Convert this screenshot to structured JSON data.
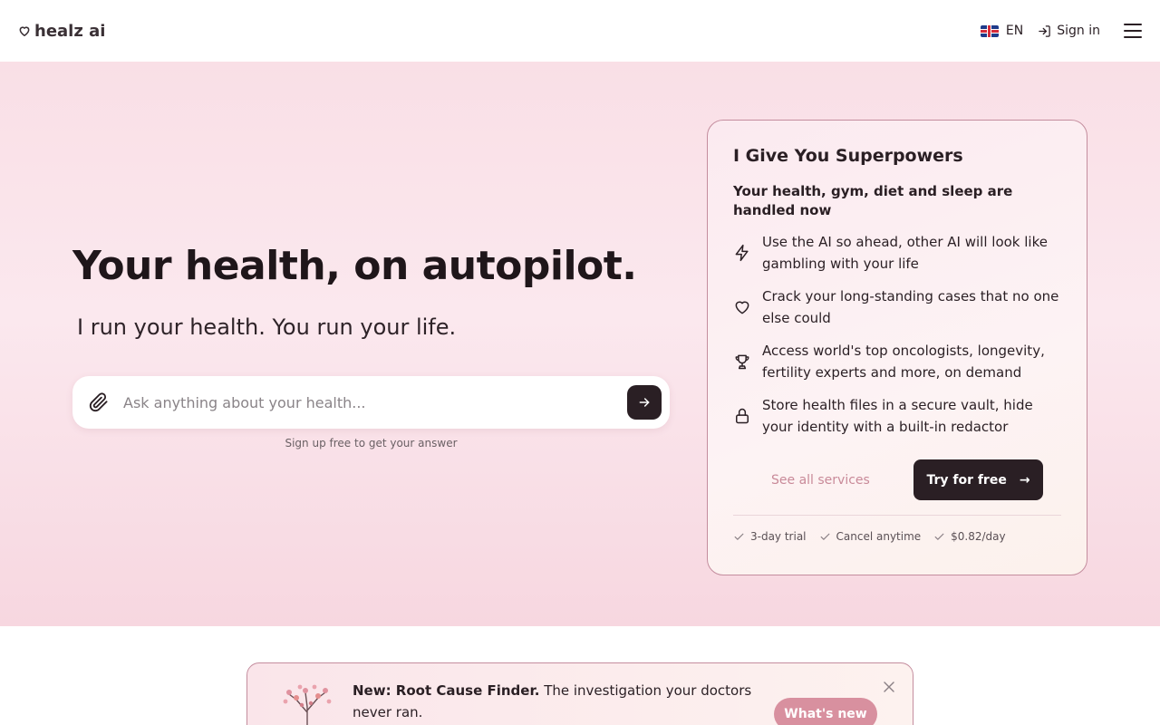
{
  "header": {
    "logo_text": "healz ai",
    "language": "EN",
    "signin_label": "Sign in"
  },
  "hero": {
    "headline": "Your health, on autopilot.",
    "subheadline": "I run your health. You run your life.",
    "ask_placeholder": "Ask anything about your health...",
    "ask_hint": "Sign up free to get your answer"
  },
  "card": {
    "title": "I Give You Superpowers",
    "lead": "Your health, gym, diet and sleep are handled now",
    "features": [
      {
        "icon": "bolt-icon",
        "text": "Use the AI so ahead, other AI will look like gambling with your life"
      },
      {
        "icon": "heart-icon",
        "text": "Crack your long-standing cases that no one else could"
      },
      {
        "icon": "trophy-icon",
        "text": "Access world's top oncologists, longevity, fertility experts and more, on demand"
      },
      {
        "icon": "lock-icon",
        "text": "Store health files in a secure vault, hide your identity with a built-in redactor"
      }
    ],
    "see_all_label": "See all services",
    "try_label": "Try for free",
    "try_arrow": "→",
    "perks": [
      "3-day trial",
      "Cancel anytime",
      "$0.82/day"
    ]
  },
  "banner": {
    "bold": "New: Root Cause Finder.",
    "text": " The investigation your doctors never ran.",
    "button_label": "What's new"
  },
  "colors": {
    "dark": "#2a1f24",
    "accent_pink": "#d8909f",
    "link_pink": "#c98a99",
    "card_border": "#c48d9e"
  }
}
